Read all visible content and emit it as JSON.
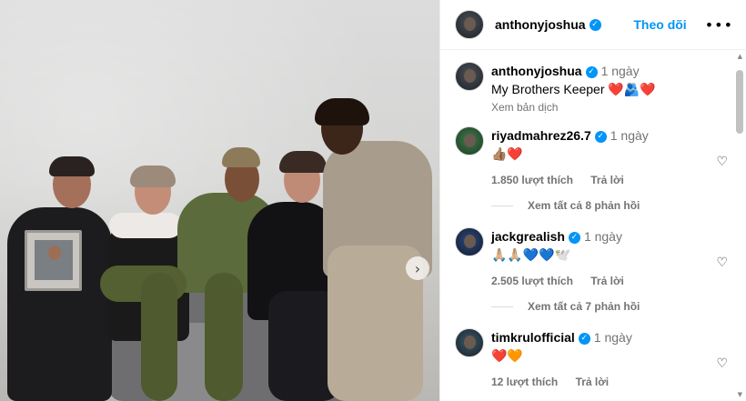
{
  "post": {
    "author": "anthonyjoshua",
    "follow_label": "Theo dõi",
    "more_label": "•••",
    "next_icon": "›"
  },
  "caption": {
    "author": "anthonyjoshua",
    "time": "1 ngày",
    "text": "My Brothers Keeper ❤️🫂❤️",
    "translate": "Xem bản dịch"
  },
  "comments": [
    {
      "author": "riyadmahrez26.7",
      "time": "1 ngày",
      "text": "👍🏽❤️",
      "likes": "1.850 lượt thích",
      "reply_label": "Trả lời",
      "view_replies": "Xem tất cả 8 phản hồi"
    },
    {
      "author": "jackgrealish",
      "time": "1 ngày",
      "text": "🙏🏼🙏🏼💙💙🕊️",
      "likes": "2.505 lượt thích",
      "reply_label": "Trả lời",
      "view_replies": "Xem tất cả 7 phản hồi"
    },
    {
      "author": "timkrulofficial",
      "time": "1 ngày",
      "text": "❤️🧡",
      "likes": "12 lượt thích",
      "reply_label": "Trả lời"
    }
  ],
  "icons": {
    "verified": "✓",
    "heart": "♡"
  },
  "colors": {
    "accent": "#0095f6",
    "muted": "#737373"
  }
}
